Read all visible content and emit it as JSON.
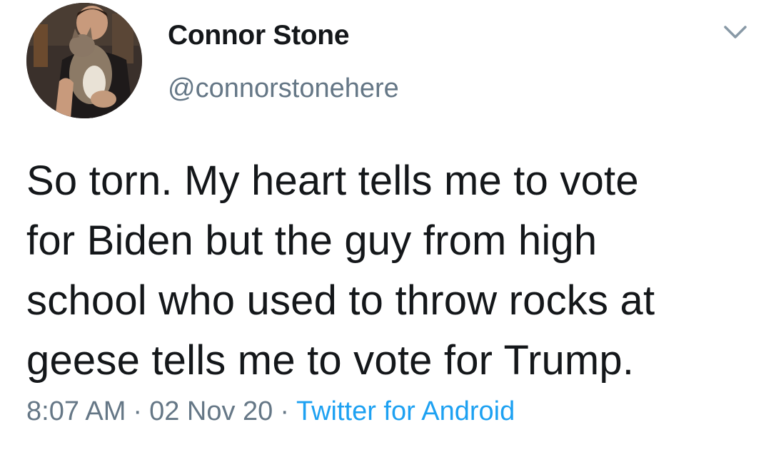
{
  "author": {
    "display_name": "Connor Stone",
    "handle": "@connorstonehere"
  },
  "tweet": {
    "lines": [
      "So torn. My heart tells me to vote",
      "for Biden but the guy from high",
      "school who used to throw rocks at",
      "geese tells me to vote for Trump."
    ]
  },
  "meta": {
    "time": "8:07 AM",
    "separator": "·",
    "date": "02 Nov 20",
    "source": "Twitter for Android"
  },
  "icons": {
    "menu": "chevron-down-icon"
  },
  "colors": {
    "text": "#14171a",
    "secondary": "#657786",
    "link": "#1da1f2",
    "background": "#ffffff"
  }
}
